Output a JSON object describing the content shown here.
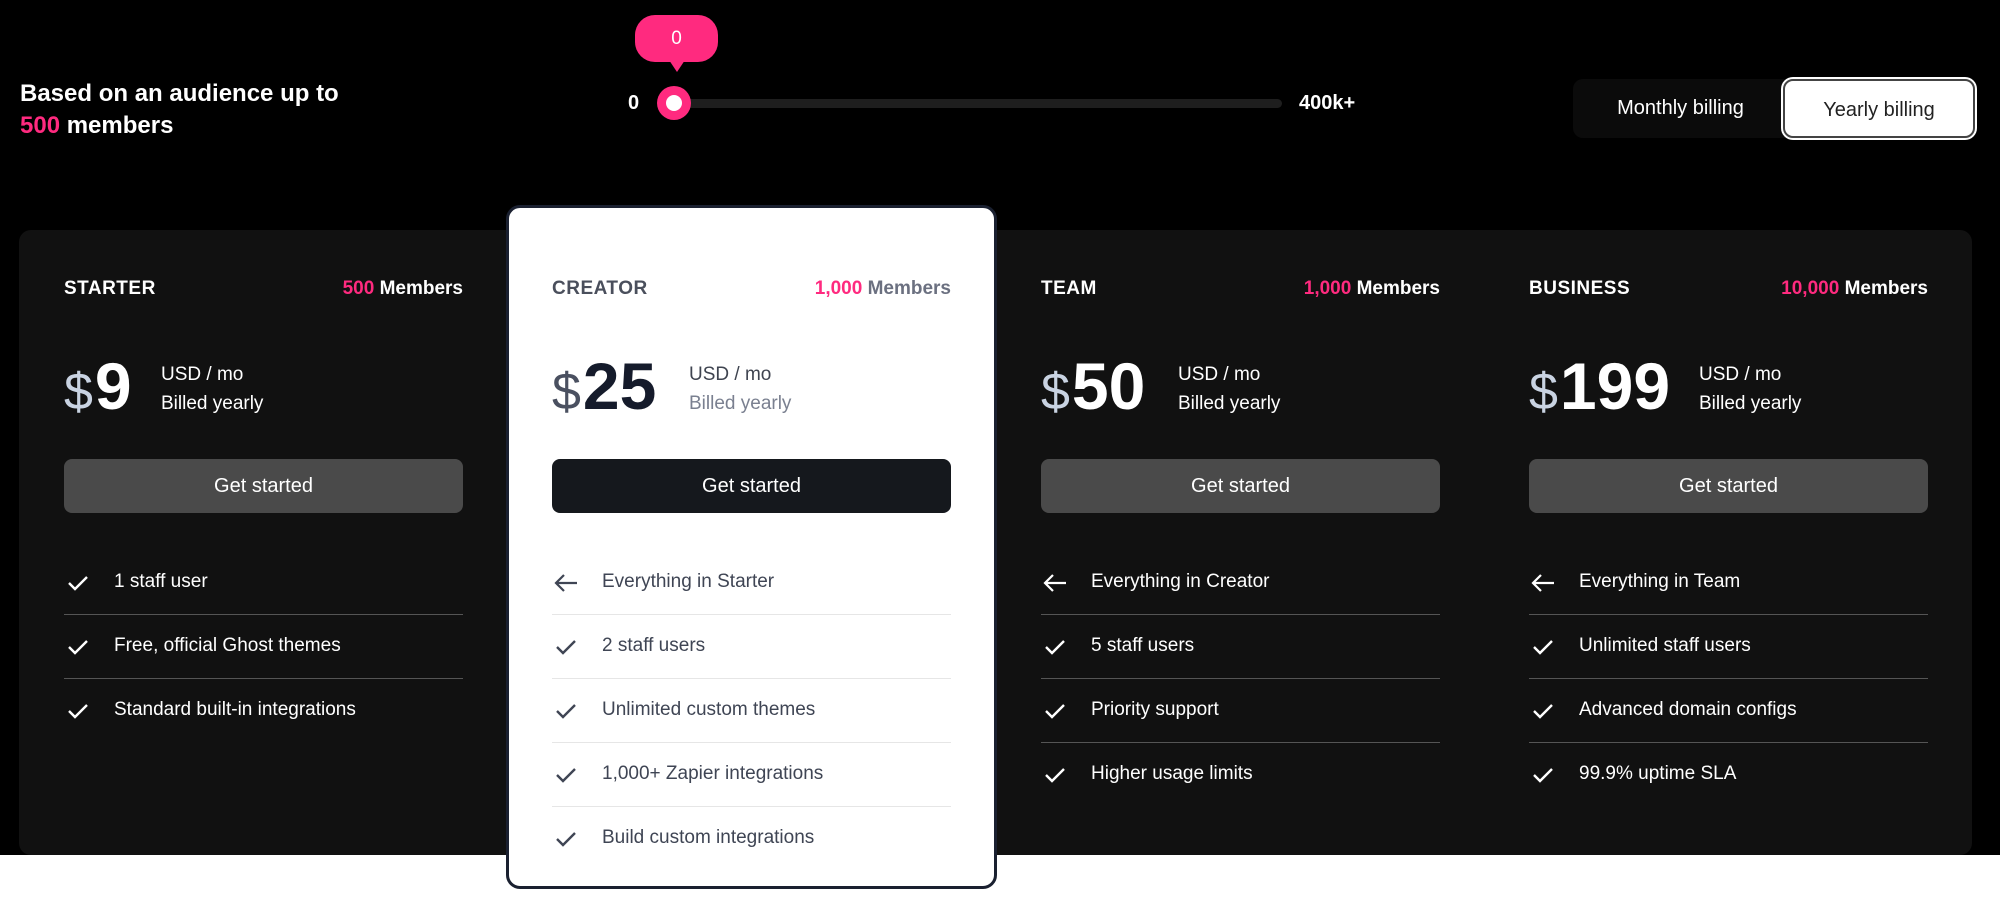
{
  "header": {
    "line1": "Based on an audience up to",
    "count": "500",
    "line2": " members"
  },
  "slider": {
    "min_label": "0",
    "max_label": "400k+",
    "value": "0",
    "value_fraction": 0
  },
  "billing": {
    "monthly": "Monthly billing",
    "yearly": "Yearly billing",
    "selected": "Yearly billing"
  },
  "colors": {
    "accent": "#ff2a7f",
    "panel": "#111111",
    "button": "#4a4a4a"
  },
  "plans": [
    {
      "name": "STARTER",
      "members_count": "500",
      "members_label": " Members",
      "currency": "$",
      "price": "9",
      "unit": "USD / mo",
      "billing": "Billed yearly",
      "cta": "Get started",
      "features": [
        {
          "icon": "check-icon",
          "text": "1 staff user"
        },
        {
          "icon": "check-icon",
          "text": "Free, official Ghost themes"
        },
        {
          "icon": "check-icon",
          "text": "Standard built-in integrations"
        }
      ]
    },
    {
      "name": "CREATOR",
      "members_count": "1,000",
      "members_label": " Members",
      "currency": "$",
      "price": "25",
      "unit": "USD / mo",
      "billing": "Billed yearly",
      "cta": "Get started",
      "highlighted": true,
      "features": [
        {
          "icon": "arrow-left-icon",
          "text": "Everything in Starter"
        },
        {
          "icon": "check-icon",
          "text": "2 staff users"
        },
        {
          "icon": "check-icon",
          "text": "Unlimited custom themes"
        },
        {
          "icon": "check-icon",
          "text": "1,000+ Zapier integrations"
        },
        {
          "icon": "check-icon",
          "text": "Build custom integrations"
        }
      ]
    },
    {
      "name": "TEAM",
      "members_count": "1,000",
      "members_label": " Members",
      "currency": "$",
      "price": "50",
      "unit": "USD / mo",
      "billing": "Billed yearly",
      "cta": "Get started",
      "features": [
        {
          "icon": "arrow-left-icon",
          "text": "Everything in Creator"
        },
        {
          "icon": "check-icon",
          "text": "5 staff users"
        },
        {
          "icon": "check-icon",
          "text": "Priority support"
        },
        {
          "icon": "check-icon",
          "text": "Higher usage limits"
        }
      ]
    },
    {
      "name": "BUSINESS",
      "members_count": "10,000",
      "members_label": " Members",
      "currency": "$",
      "price": "199",
      "unit": "USD / mo",
      "billing": "Billed yearly",
      "cta": "Get started",
      "features": [
        {
          "icon": "arrow-left-icon",
          "text": "Everything in Team"
        },
        {
          "icon": "check-icon",
          "text": "Unlimited staff users"
        },
        {
          "icon": "check-icon",
          "text": "Advanced domain configs"
        },
        {
          "icon": "check-icon",
          "text": "99.9% uptime SLA"
        }
      ]
    }
  ]
}
